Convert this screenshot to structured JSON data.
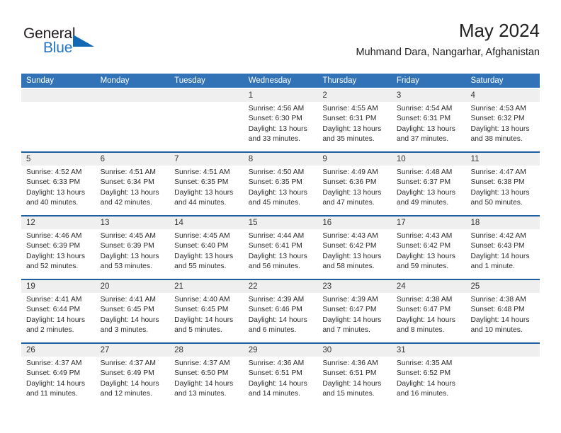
{
  "brand": {
    "name_part1": "General",
    "name_part2": "Blue",
    "triangle_icon": "triangle-icon",
    "colors": {
      "dark": "#231f20",
      "blue": "#2176c7",
      "triangle": "#1268b3"
    }
  },
  "header": {
    "title": "May 2024",
    "subtitle": "Muhmand Dara, Nangarhar, Afghanistan"
  },
  "theme": {
    "header_blue": "#3173b6",
    "row_divider_blue": "#1f5fa0",
    "daynum_band": "#efefef",
    "text": "#2b2b2b"
  },
  "weekdays": [
    "Sunday",
    "Monday",
    "Tuesday",
    "Wednesday",
    "Thursday",
    "Friday",
    "Saturday"
  ],
  "weeks": [
    [
      {
        "day": "",
        "blank": true,
        "sunrise": "",
        "sunset": "",
        "daylight1": "",
        "daylight2": ""
      },
      {
        "day": "",
        "blank": true,
        "sunrise": "",
        "sunset": "",
        "daylight1": "",
        "daylight2": ""
      },
      {
        "day": "",
        "blank": true,
        "sunrise": "",
        "sunset": "",
        "daylight1": "",
        "daylight2": ""
      },
      {
        "day": "1",
        "blank": false,
        "sunrise": "Sunrise: 4:56 AM",
        "sunset": "Sunset: 6:30 PM",
        "daylight1": "Daylight: 13 hours",
        "daylight2": "and 33 minutes."
      },
      {
        "day": "2",
        "blank": false,
        "sunrise": "Sunrise: 4:55 AM",
        "sunset": "Sunset: 6:31 PM",
        "daylight1": "Daylight: 13 hours",
        "daylight2": "and 35 minutes."
      },
      {
        "day": "3",
        "blank": false,
        "sunrise": "Sunrise: 4:54 AM",
        "sunset": "Sunset: 6:31 PM",
        "daylight1": "Daylight: 13 hours",
        "daylight2": "and 37 minutes."
      },
      {
        "day": "4",
        "blank": false,
        "sunrise": "Sunrise: 4:53 AM",
        "sunset": "Sunset: 6:32 PM",
        "daylight1": "Daylight: 13 hours",
        "daylight2": "and 38 minutes."
      }
    ],
    [
      {
        "day": "5",
        "blank": false,
        "sunrise": "Sunrise: 4:52 AM",
        "sunset": "Sunset: 6:33 PM",
        "daylight1": "Daylight: 13 hours",
        "daylight2": "and 40 minutes."
      },
      {
        "day": "6",
        "blank": false,
        "sunrise": "Sunrise: 4:51 AM",
        "sunset": "Sunset: 6:34 PM",
        "daylight1": "Daylight: 13 hours",
        "daylight2": "and 42 minutes."
      },
      {
        "day": "7",
        "blank": false,
        "sunrise": "Sunrise: 4:51 AM",
        "sunset": "Sunset: 6:35 PM",
        "daylight1": "Daylight: 13 hours",
        "daylight2": "and 44 minutes."
      },
      {
        "day": "8",
        "blank": false,
        "sunrise": "Sunrise: 4:50 AM",
        "sunset": "Sunset: 6:35 PM",
        "daylight1": "Daylight: 13 hours",
        "daylight2": "and 45 minutes."
      },
      {
        "day": "9",
        "blank": false,
        "sunrise": "Sunrise: 4:49 AM",
        "sunset": "Sunset: 6:36 PM",
        "daylight1": "Daylight: 13 hours",
        "daylight2": "and 47 minutes."
      },
      {
        "day": "10",
        "blank": false,
        "sunrise": "Sunrise: 4:48 AM",
        "sunset": "Sunset: 6:37 PM",
        "daylight1": "Daylight: 13 hours",
        "daylight2": "and 49 minutes."
      },
      {
        "day": "11",
        "blank": false,
        "sunrise": "Sunrise: 4:47 AM",
        "sunset": "Sunset: 6:38 PM",
        "daylight1": "Daylight: 13 hours",
        "daylight2": "and 50 minutes."
      }
    ],
    [
      {
        "day": "12",
        "blank": false,
        "sunrise": "Sunrise: 4:46 AM",
        "sunset": "Sunset: 6:39 PM",
        "daylight1": "Daylight: 13 hours",
        "daylight2": "and 52 minutes."
      },
      {
        "day": "13",
        "blank": false,
        "sunrise": "Sunrise: 4:45 AM",
        "sunset": "Sunset: 6:39 PM",
        "daylight1": "Daylight: 13 hours",
        "daylight2": "and 53 minutes."
      },
      {
        "day": "14",
        "blank": false,
        "sunrise": "Sunrise: 4:45 AM",
        "sunset": "Sunset: 6:40 PM",
        "daylight1": "Daylight: 13 hours",
        "daylight2": "and 55 minutes."
      },
      {
        "day": "15",
        "blank": false,
        "sunrise": "Sunrise: 4:44 AM",
        "sunset": "Sunset: 6:41 PM",
        "daylight1": "Daylight: 13 hours",
        "daylight2": "and 56 minutes."
      },
      {
        "day": "16",
        "blank": false,
        "sunrise": "Sunrise: 4:43 AM",
        "sunset": "Sunset: 6:42 PM",
        "daylight1": "Daylight: 13 hours",
        "daylight2": "and 58 minutes."
      },
      {
        "day": "17",
        "blank": false,
        "sunrise": "Sunrise: 4:43 AM",
        "sunset": "Sunset: 6:42 PM",
        "daylight1": "Daylight: 13 hours",
        "daylight2": "and 59 minutes."
      },
      {
        "day": "18",
        "blank": false,
        "sunrise": "Sunrise: 4:42 AM",
        "sunset": "Sunset: 6:43 PM",
        "daylight1": "Daylight: 14 hours",
        "daylight2": "and 1 minute."
      }
    ],
    [
      {
        "day": "19",
        "blank": false,
        "sunrise": "Sunrise: 4:41 AM",
        "sunset": "Sunset: 6:44 PM",
        "daylight1": "Daylight: 14 hours",
        "daylight2": "and 2 minutes."
      },
      {
        "day": "20",
        "blank": false,
        "sunrise": "Sunrise: 4:41 AM",
        "sunset": "Sunset: 6:45 PM",
        "daylight1": "Daylight: 14 hours",
        "daylight2": "and 3 minutes."
      },
      {
        "day": "21",
        "blank": false,
        "sunrise": "Sunrise: 4:40 AM",
        "sunset": "Sunset: 6:45 PM",
        "daylight1": "Daylight: 14 hours",
        "daylight2": "and 5 minutes."
      },
      {
        "day": "22",
        "blank": false,
        "sunrise": "Sunrise: 4:39 AM",
        "sunset": "Sunset: 6:46 PM",
        "daylight1": "Daylight: 14 hours",
        "daylight2": "and 6 minutes."
      },
      {
        "day": "23",
        "blank": false,
        "sunrise": "Sunrise: 4:39 AM",
        "sunset": "Sunset: 6:47 PM",
        "daylight1": "Daylight: 14 hours",
        "daylight2": "and 7 minutes."
      },
      {
        "day": "24",
        "blank": false,
        "sunrise": "Sunrise: 4:38 AM",
        "sunset": "Sunset: 6:47 PM",
        "daylight1": "Daylight: 14 hours",
        "daylight2": "and 8 minutes."
      },
      {
        "day": "25",
        "blank": false,
        "sunrise": "Sunrise: 4:38 AM",
        "sunset": "Sunset: 6:48 PM",
        "daylight1": "Daylight: 14 hours",
        "daylight2": "and 10 minutes."
      }
    ],
    [
      {
        "day": "26",
        "blank": false,
        "sunrise": "Sunrise: 4:37 AM",
        "sunset": "Sunset: 6:49 PM",
        "daylight1": "Daylight: 14 hours",
        "daylight2": "and 11 minutes."
      },
      {
        "day": "27",
        "blank": false,
        "sunrise": "Sunrise: 4:37 AM",
        "sunset": "Sunset: 6:49 PM",
        "daylight1": "Daylight: 14 hours",
        "daylight2": "and 12 minutes."
      },
      {
        "day": "28",
        "blank": false,
        "sunrise": "Sunrise: 4:37 AM",
        "sunset": "Sunset: 6:50 PM",
        "daylight1": "Daylight: 14 hours",
        "daylight2": "and 13 minutes."
      },
      {
        "day": "29",
        "blank": false,
        "sunrise": "Sunrise: 4:36 AM",
        "sunset": "Sunset: 6:51 PM",
        "daylight1": "Daylight: 14 hours",
        "daylight2": "and 14 minutes."
      },
      {
        "day": "30",
        "blank": false,
        "sunrise": "Sunrise: 4:36 AM",
        "sunset": "Sunset: 6:51 PM",
        "daylight1": "Daylight: 14 hours",
        "daylight2": "and 15 minutes."
      },
      {
        "day": "31",
        "blank": false,
        "sunrise": "Sunrise: 4:35 AM",
        "sunset": "Sunset: 6:52 PM",
        "daylight1": "Daylight: 14 hours",
        "daylight2": "and 16 minutes."
      },
      {
        "day": "",
        "blank": true,
        "sunrise": "",
        "sunset": "",
        "daylight1": "",
        "daylight2": ""
      }
    ]
  ]
}
